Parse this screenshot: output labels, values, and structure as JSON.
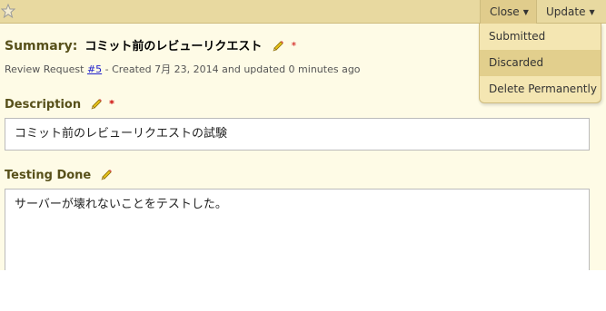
{
  "toolbar": {
    "star_icon": "star-outline-icon",
    "close_label": "Close",
    "update_label": "Update",
    "caret": "▼"
  },
  "close_menu": {
    "items": [
      "Submitted",
      "Discarded",
      "Delete Permanently"
    ],
    "hovered": "Discarded"
  },
  "summary": {
    "label": "Summary:",
    "text": "コミット前のレビューリクエスト",
    "required_mark": "*"
  },
  "meta": {
    "prefix": "Review Request",
    "request_link": "#5",
    "suffix": "- Created 7月 23, 2014 and updated 0 minutes ago"
  },
  "description": {
    "label": "Description",
    "required_mark": "*",
    "text": "コミット前のレビューリクエストの試験"
  },
  "testing_done": {
    "label": "Testing Done",
    "text": "サーバーが壊れないことをテストした。"
  },
  "colors": {
    "header_bar": "#e8d9a0",
    "page_background": "#fefbe6",
    "label_color": "#57501a",
    "required_color": "#cc0000",
    "link_color": "#2222cc"
  }
}
